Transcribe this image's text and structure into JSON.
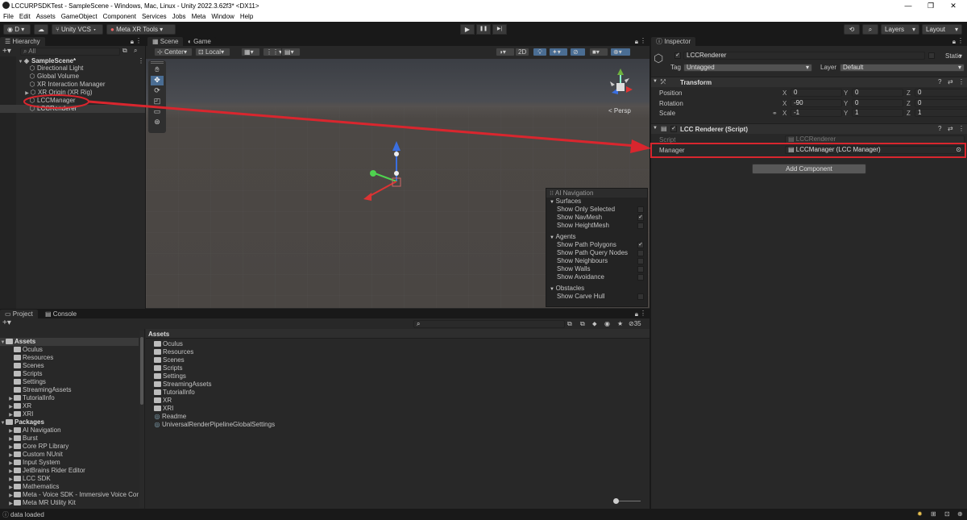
{
  "window": {
    "title": "LCCURPSDKTest - SampleScene - Windows, Mac, Linux - Unity 2022.3.62f3* <DX11>",
    "minimize": "—",
    "maximize": "❐",
    "close": "✕"
  },
  "menu": [
    "File",
    "Edit",
    "Assets",
    "GameObject",
    "Component",
    "Services",
    "Jobs",
    "Meta",
    "Window",
    "Help"
  ],
  "toolbar": {
    "account": "D ▾",
    "unity_vcs": "Unity VCS ▾",
    "meta_xr": "Meta XR Tools ▾",
    "play": "▶",
    "pause": "❚❚",
    "step": "▶|",
    "layers": "Layers",
    "layout": "Layout"
  },
  "hierarchy": {
    "tab": "Hierarchy",
    "search_placeholder": "All",
    "root": "SampleScene*",
    "items": [
      "Directional Light",
      "Global Volume",
      "XR Interaction Manager",
      "XR Origin (XR Rig)",
      "LCCManager",
      "LCCRenderer"
    ]
  },
  "scene": {
    "tabs": [
      "Scene",
      "Game"
    ],
    "pivot": "Center",
    "space": "Local",
    "mode_2d": "2D",
    "persp": "< Persp"
  },
  "ai_navigation": {
    "title": "AI Navigation",
    "sections": [
      {
        "name": "Surfaces",
        "items": [
          {
            "label": "Show Only Selected",
            "checked": false
          },
          {
            "label": "Show NavMesh",
            "checked": true
          },
          {
            "label": "Show HeightMesh",
            "checked": false
          }
        ]
      },
      {
        "name": "Agents",
        "items": [
          {
            "label": "Show Path Polygons",
            "checked": true
          },
          {
            "label": "Show Path Query Nodes",
            "checked": false
          },
          {
            "label": "Show Neighbours",
            "checked": false
          },
          {
            "label": "Show Walls",
            "checked": false
          },
          {
            "label": "Show Avoidance",
            "checked": false
          }
        ]
      },
      {
        "name": "Obstacles",
        "items": [
          {
            "label": "Show Carve Hull",
            "checked": false
          }
        ]
      }
    ]
  },
  "inspector": {
    "tab": "Inspector",
    "object_name": "LCCRenderer",
    "static_label": "Static",
    "tag_label": "Tag",
    "tag_value": "Untagged",
    "layer_label": "Layer",
    "layer_value": "Default",
    "transform": {
      "title": "Transform",
      "rows": [
        {
          "label": "Position",
          "x": "0",
          "y": "0",
          "z": "0"
        },
        {
          "label": "Rotation",
          "x": "-90",
          "y": "0",
          "z": "0"
        },
        {
          "label": "Scale",
          "x": "-1",
          "y": "1",
          "z": "1"
        }
      ]
    },
    "script_component": {
      "title": "LCC Renderer (Script)",
      "script_label": "Script",
      "script_value": "LCCRenderer",
      "manager_label": "Manager",
      "manager_value": "LCCManager (LCC Manager)"
    },
    "add_component": "Add Component"
  },
  "project": {
    "tabs": [
      "Project",
      "Console"
    ],
    "tree_assets_label": "Assets",
    "tree_assets": [
      "Oculus",
      "Resources",
      "Scenes",
      "Scripts",
      "Settings",
      "StreamingAssets",
      "TutorialInfo",
      "XR",
      "XRI"
    ],
    "tree_packages_label": "Packages",
    "tree_packages": [
      "AI Navigation",
      "Burst",
      "Core RP Library",
      "Custom NUnit",
      "Input System",
      "JetBrains Rider Editor",
      "LCC SDK",
      "Mathematics",
      "Meta - Voice SDK - Immersive Voice Cor",
      "Meta MR Utility Kit"
    ],
    "breadcrumb": "Assets",
    "content_folders": [
      "Oculus",
      "Resources",
      "Scenes",
      "Scripts",
      "Settings",
      "StreamingAssets",
      "TutorialInfo",
      "XR",
      "XRI"
    ],
    "content_files": [
      "Readme",
      "UniversalRenderPipelineGlobalSettings"
    ],
    "hidden_count": "35"
  },
  "status": {
    "text": "data loaded"
  },
  "annotation_color": "#d9262e"
}
